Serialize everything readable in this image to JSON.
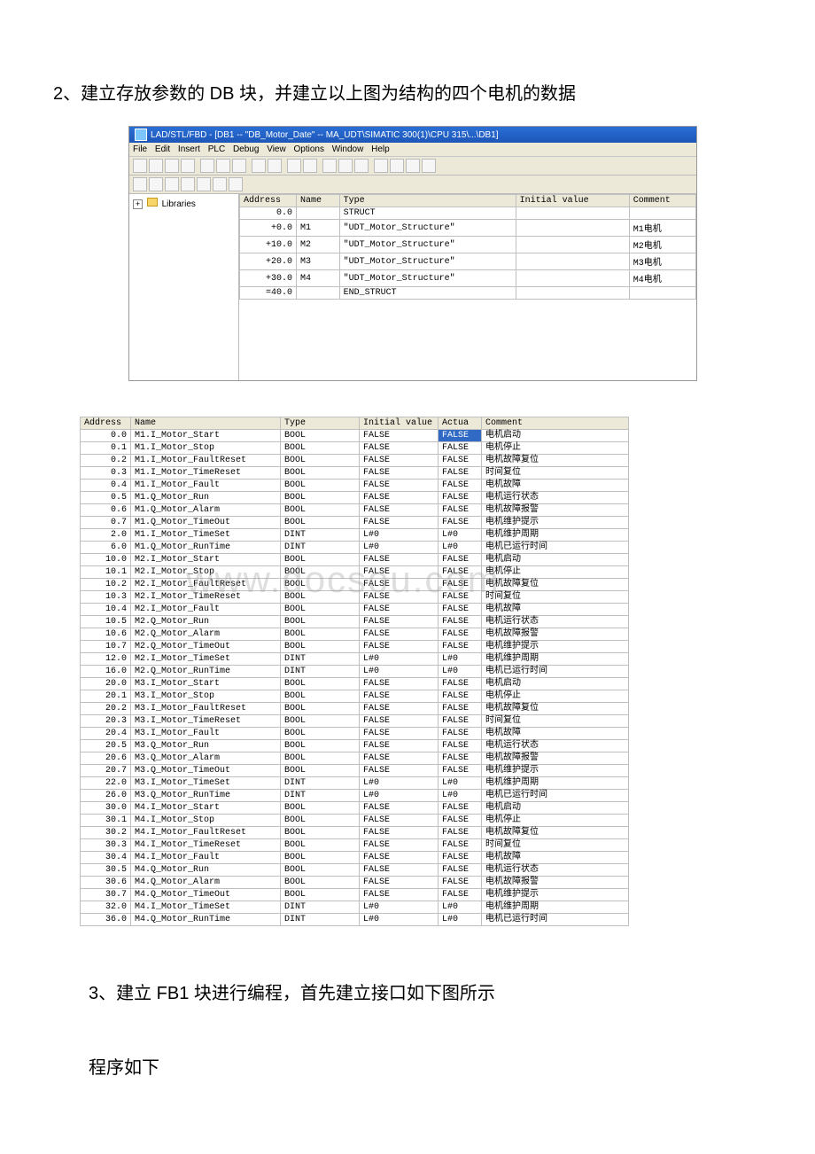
{
  "text": {
    "para1": "2、建立存放参数的 DB 块，并建立以上图为结构的四个电机的数据",
    "para2": "3、建立 FB1 块进行编程，首先建立接口如下图所示",
    "para3": "程序如下"
  },
  "editor": {
    "title": "LAD/STL/FBD  - [DB1 -- \"DB_Motor_Date\" -- MA_UDT\\SIMATIC 300(1)\\CPU 315\\...\\DB1]",
    "menu": [
      "File",
      "Edit",
      "Insert",
      "PLC",
      "Debug",
      "View",
      "Options",
      "Window",
      "Help"
    ],
    "tree": {
      "root": "Libraries"
    },
    "grid": {
      "headers": [
        "Address",
        "Name",
        "Type",
        "Initial value",
        "Comment"
      ],
      "rows": [
        {
          "addr": "0.0",
          "name": "",
          "type": "STRUCT",
          "iv": "",
          "comment": ""
        },
        {
          "addr": "+0.0",
          "name": "M1",
          "type": "\"UDT_Motor_Structure\"",
          "iv": "",
          "comment": "M1电机"
        },
        {
          "addr": "+10.0",
          "name": "M2",
          "type": "\"UDT_Motor_Structure\"",
          "iv": "",
          "comment": "M2电机"
        },
        {
          "addr": "+20.0",
          "name": "M3",
          "type": "\"UDT_Motor_Structure\"",
          "iv": "",
          "comment": "M3电机"
        },
        {
          "addr": "+30.0",
          "name": "M4",
          "type": "\"UDT_Motor_Structure\"",
          "iv": "",
          "comment": "M4电机"
        },
        {
          "addr": "=40.0",
          "name": "",
          "type": "END_STRUCT",
          "iv": "",
          "comment": ""
        }
      ]
    }
  },
  "detail": {
    "headers": [
      "Address",
      "Name",
      "Type",
      "Initial value",
      "Actua",
      "Comment"
    ],
    "watermark": "www.docsou.com",
    "rows": [
      {
        "addr": "0.0",
        "name": "M1.I_Motor_Start",
        "type": "BOOL",
        "iv": "FALSE",
        "av": "FALSE",
        "comment": "电机启动",
        "sel": true
      },
      {
        "addr": "0.1",
        "name": "M1.I_Motor_Stop",
        "type": "BOOL",
        "iv": "FALSE",
        "av": "FALSE",
        "comment": "电机停止"
      },
      {
        "addr": "0.2",
        "name": "M1.I_Motor_FaultReset",
        "type": "BOOL",
        "iv": "FALSE",
        "av": "FALSE",
        "comment": "电机故障复位"
      },
      {
        "addr": "0.3",
        "name": "M1.I_Motor_TimeReset",
        "type": "BOOL",
        "iv": "FALSE",
        "av": "FALSE",
        "comment": "时间复位"
      },
      {
        "addr": "0.4",
        "name": "M1.I_Motor_Fault",
        "type": "BOOL",
        "iv": "FALSE",
        "av": "FALSE",
        "comment": "电机故障"
      },
      {
        "addr": "0.5",
        "name": "M1.Q_Motor_Run",
        "type": "BOOL",
        "iv": "FALSE",
        "av": "FALSE",
        "comment": "电机运行状态"
      },
      {
        "addr": "0.6",
        "name": "M1.Q_Motor_Alarm",
        "type": "BOOL",
        "iv": "FALSE",
        "av": "FALSE",
        "comment": "电机故障报警"
      },
      {
        "addr": "0.7",
        "name": "M1.Q_Motor_TimeOut",
        "type": "BOOL",
        "iv": "FALSE",
        "av": "FALSE",
        "comment": "电机维护提示"
      },
      {
        "addr": "2.0",
        "name": "M1.I_Motor_TimeSet",
        "type": "DINT",
        "iv": "L#0",
        "av": "L#0",
        "comment": "电机维护周期"
      },
      {
        "addr": "6.0",
        "name": "M1.Q_Motor_RunTime",
        "type": "DINT",
        "iv": "L#0",
        "av": "L#0",
        "comment": "电机已运行时间"
      },
      {
        "addr": "10.0",
        "name": "M2.I_Motor_Start",
        "type": "BOOL",
        "iv": "FALSE",
        "av": "FALSE",
        "comment": "电机启动"
      },
      {
        "addr": "10.1",
        "name": "M2.I_Motor_Stop",
        "type": "BOOL",
        "iv": "FALSE",
        "av": "FALSE",
        "comment": "电机停止"
      },
      {
        "addr": "10.2",
        "name": "M2.I_Motor_FaultReset",
        "type": "BOOL",
        "iv": "FALSE",
        "av": "FALSE",
        "comment": "电机故障复位"
      },
      {
        "addr": "10.3",
        "name": "M2.I_Motor_TimeReset",
        "type": "BOOL",
        "iv": "FALSE",
        "av": "FALSE",
        "comment": "时间复位"
      },
      {
        "addr": "10.4",
        "name": "M2.I_Motor_Fault",
        "type": "BOOL",
        "iv": "FALSE",
        "av": "FALSE",
        "comment": "电机故障"
      },
      {
        "addr": "10.5",
        "name": "M2.Q_Motor_Run",
        "type": "BOOL",
        "iv": "FALSE",
        "av": "FALSE",
        "comment": "电机运行状态"
      },
      {
        "addr": "10.6",
        "name": "M2.Q_Motor_Alarm",
        "type": "BOOL",
        "iv": "FALSE",
        "av": "FALSE",
        "comment": "电机故障报警"
      },
      {
        "addr": "10.7",
        "name": "M2.Q_Motor_TimeOut",
        "type": "BOOL",
        "iv": "FALSE",
        "av": "FALSE",
        "comment": "电机维护提示"
      },
      {
        "addr": "12.0",
        "name": "M2.I_Motor_TimeSet",
        "type": "DINT",
        "iv": "L#0",
        "av": "L#0",
        "comment": "电机维护周期"
      },
      {
        "addr": "16.0",
        "name": "M2.Q_Motor_RunTime",
        "type": "DINT",
        "iv": "L#0",
        "av": "L#0",
        "comment": "电机已运行时间"
      },
      {
        "addr": "20.0",
        "name": "M3.I_Motor_Start",
        "type": "BOOL",
        "iv": "FALSE",
        "av": "FALSE",
        "comment": "电机启动"
      },
      {
        "addr": "20.1",
        "name": "M3.I_Motor_Stop",
        "type": "BOOL",
        "iv": "FALSE",
        "av": "FALSE",
        "comment": "电机停止"
      },
      {
        "addr": "20.2",
        "name": "M3.I_Motor_FaultReset",
        "type": "BOOL",
        "iv": "FALSE",
        "av": "FALSE",
        "comment": "电机故障复位"
      },
      {
        "addr": "20.3",
        "name": "M3.I_Motor_TimeReset",
        "type": "BOOL",
        "iv": "FALSE",
        "av": "FALSE",
        "comment": "时间复位"
      },
      {
        "addr": "20.4",
        "name": "M3.I_Motor_Fault",
        "type": "BOOL",
        "iv": "FALSE",
        "av": "FALSE",
        "comment": "电机故障"
      },
      {
        "addr": "20.5",
        "name": "M3.Q_Motor_Run",
        "type": "BOOL",
        "iv": "FALSE",
        "av": "FALSE",
        "comment": "电机运行状态"
      },
      {
        "addr": "20.6",
        "name": "M3.Q_Motor_Alarm",
        "type": "BOOL",
        "iv": "FALSE",
        "av": "FALSE",
        "comment": "电机故障报警"
      },
      {
        "addr": "20.7",
        "name": "M3.Q_Motor_TimeOut",
        "type": "BOOL",
        "iv": "FALSE",
        "av": "FALSE",
        "comment": "电机维护提示"
      },
      {
        "addr": "22.0",
        "name": "M3.I_Motor_TimeSet",
        "type": "DINT",
        "iv": "L#0",
        "av": "L#0",
        "comment": "电机维护周期"
      },
      {
        "addr": "26.0",
        "name": "M3.Q_Motor_RunTime",
        "type": "DINT",
        "iv": "L#0",
        "av": "L#0",
        "comment": "电机已运行时间"
      },
      {
        "addr": "30.0",
        "name": "M4.I_Motor_Start",
        "type": "BOOL",
        "iv": "FALSE",
        "av": "FALSE",
        "comment": "电机启动"
      },
      {
        "addr": "30.1",
        "name": "M4.I_Motor_Stop",
        "type": "BOOL",
        "iv": "FALSE",
        "av": "FALSE",
        "comment": "电机停止"
      },
      {
        "addr": "30.2",
        "name": "M4.I_Motor_FaultReset",
        "type": "BOOL",
        "iv": "FALSE",
        "av": "FALSE",
        "comment": "电机故障复位"
      },
      {
        "addr": "30.3",
        "name": "M4.I_Motor_TimeReset",
        "type": "BOOL",
        "iv": "FALSE",
        "av": "FALSE",
        "comment": "时间复位"
      },
      {
        "addr": "30.4",
        "name": "M4.I_Motor_Fault",
        "type": "BOOL",
        "iv": "FALSE",
        "av": "FALSE",
        "comment": "电机故障"
      },
      {
        "addr": "30.5",
        "name": "M4.Q_Motor_Run",
        "type": "BOOL",
        "iv": "FALSE",
        "av": "FALSE",
        "comment": "电机运行状态"
      },
      {
        "addr": "30.6",
        "name": "M4.Q_Motor_Alarm",
        "type": "BOOL",
        "iv": "FALSE",
        "av": "FALSE",
        "comment": "电机故障报警"
      },
      {
        "addr": "30.7",
        "name": "M4.Q_Motor_TimeOut",
        "type": "BOOL",
        "iv": "FALSE",
        "av": "FALSE",
        "comment": "电机维护提示"
      },
      {
        "addr": "32.0",
        "name": "M4.I_Motor_TimeSet",
        "type": "DINT",
        "iv": "L#0",
        "av": "L#0",
        "comment": "电机维护周期"
      },
      {
        "addr": "36.0",
        "name": "M4.Q_Motor_RunTime",
        "type": "DINT",
        "iv": "L#0",
        "av": "L#0",
        "comment": "电机已运行时间"
      }
    ]
  }
}
